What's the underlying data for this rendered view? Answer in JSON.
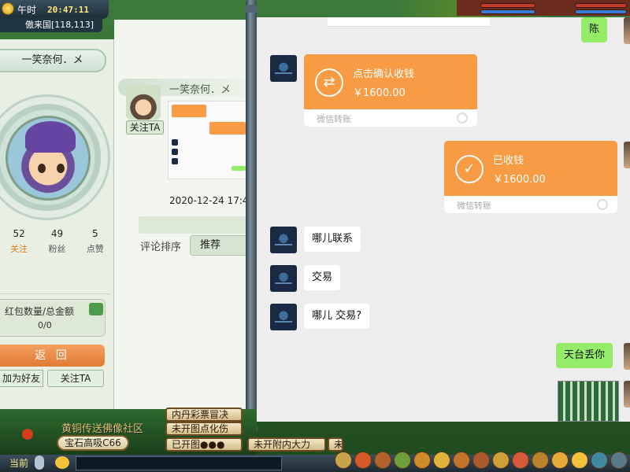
{
  "hud": {
    "period": "午时",
    "clock": "20:47:11",
    "location": "傲来国[118,113]"
  },
  "profile": {
    "name": "一笑奈何．メ",
    "stats": [
      {
        "num": "52",
        "label": "关注"
      },
      {
        "num": "49",
        "label": "粉丝"
      },
      {
        "num": "5",
        "label": "点赞"
      }
    ],
    "redpack_label": "红包数量/总金额",
    "redpack_value": "0/0",
    "back_label": "返 回",
    "friend_label": "加为好友",
    "follow_label": "关注TA"
  },
  "feed": {
    "username": "一笑奈何．メ",
    "follow_label": "关注TA",
    "date": "2020-12-24 17:4",
    "sort_label": "评论排序",
    "sort_value": "推荐"
  },
  "chat": {
    "messages": [
      {
        "side": "right",
        "text": "陈"
      },
      {
        "side": "left",
        "type": "transfer",
        "title": "点击确认收钱",
        "amount": "￥1600.00",
        "footer": "微信转账"
      },
      {
        "side": "right",
        "type": "transfer",
        "title": "已收钱",
        "amount": "￥1600.00",
        "footer": "微信转账"
      },
      {
        "side": "left",
        "text": "哪儿联系"
      },
      {
        "side": "left",
        "text": "交易"
      },
      {
        "side": "left",
        "text": "哪儿 交易?"
      },
      {
        "side": "right",
        "text": "天台丢你"
      }
    ]
  },
  "bottom": {
    "npc_line": "黄铜传送佛像社区",
    "gem_label": "宝石高吸C66",
    "scroll_items": [
      "内丹彩票冒决",
      "未开图点化伤",
      "已开图●●●",
      "未开附内大力",
      "未"
    ],
    "chat_label": "当前"
  },
  "colors": {
    "wechat_green": "#95ec69",
    "transfer_orange": "#f79c44",
    "chat_bg": "#ededed"
  }
}
